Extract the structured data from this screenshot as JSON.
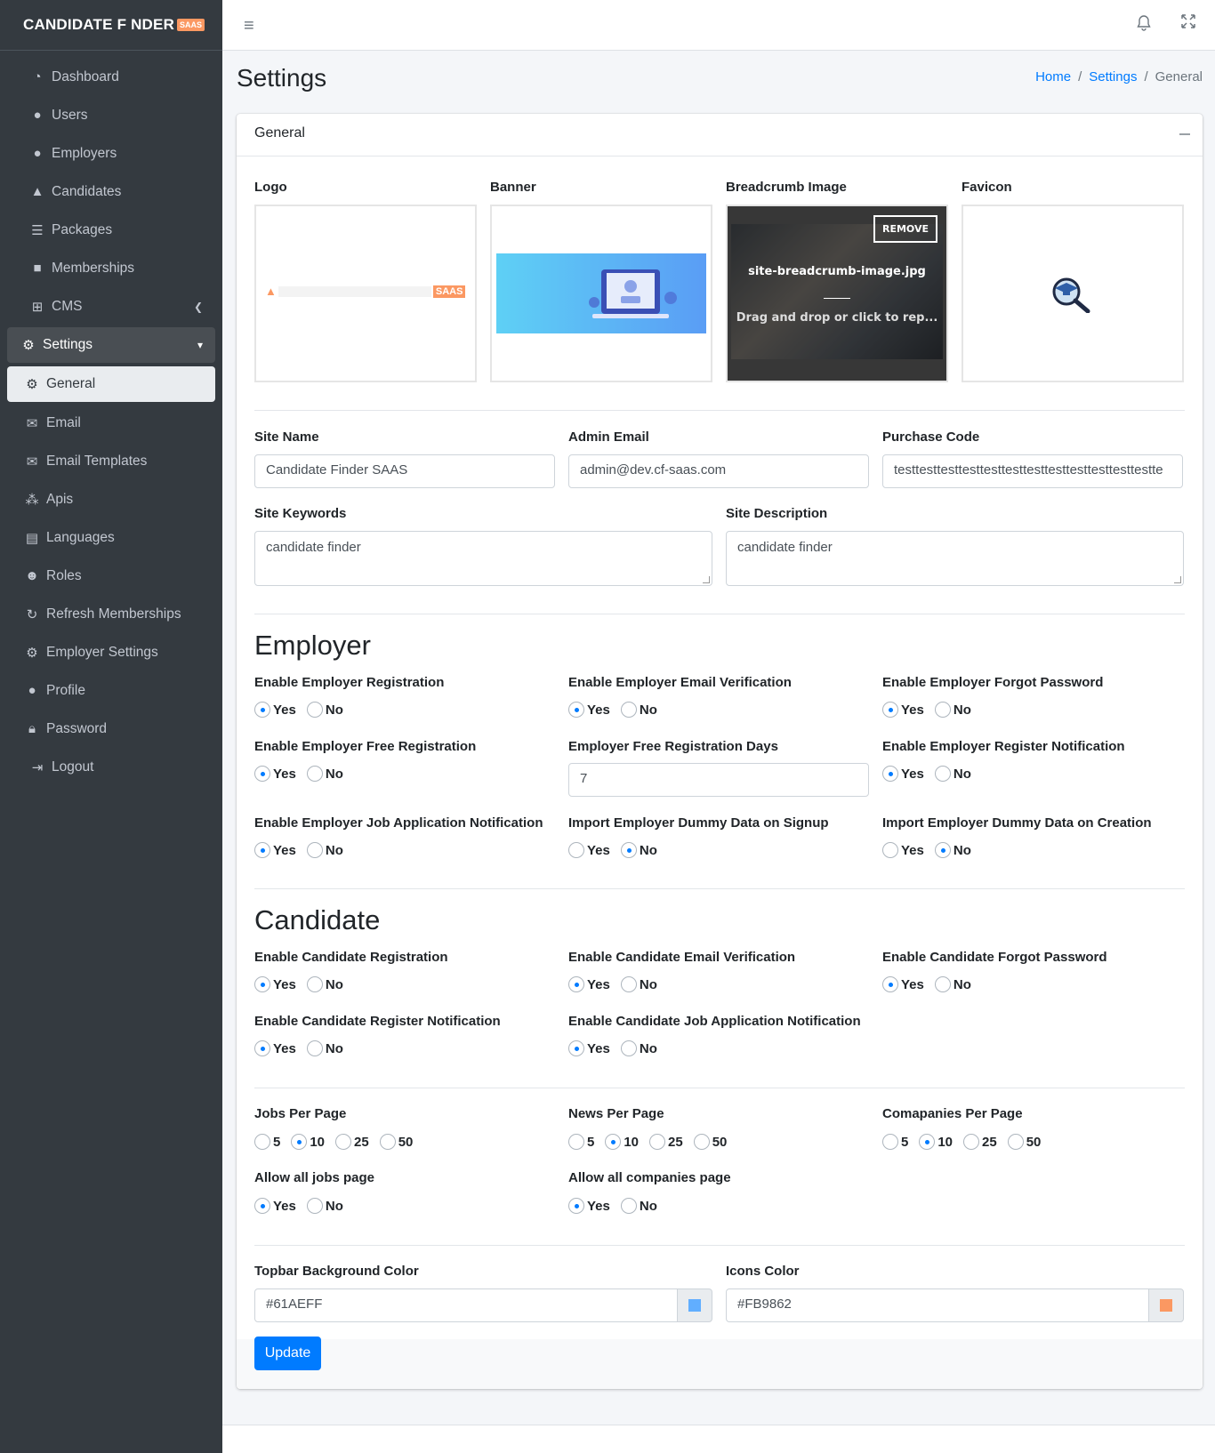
{
  "brand": {
    "name": "CANDIDATE F NDER",
    "badge": "SAAS"
  },
  "sidebar": {
    "items": [
      {
        "label": "Dashboard",
        "icon": "dashboard-icon"
      },
      {
        "label": "Users",
        "icon": "user-icon"
      },
      {
        "label": "Employers",
        "icon": "employer-icon"
      },
      {
        "label": "Candidates",
        "icon": "candidate-icon"
      },
      {
        "label": "Packages",
        "icon": "table-icon"
      },
      {
        "label": "Memberships",
        "icon": "membership-icon"
      },
      {
        "label": "CMS",
        "icon": "sitemap-icon"
      },
      {
        "label": "Settings",
        "icon": "cogs-icon"
      },
      {
        "label": "General",
        "icon": "cog-icon"
      },
      {
        "label": "Email",
        "icon": "envelope-icon"
      },
      {
        "label": "Email Templates",
        "icon": "envelope-icon"
      },
      {
        "label": "Apis",
        "icon": "api-icon"
      },
      {
        "label": "Languages",
        "icon": "language-icon"
      },
      {
        "label": "Roles",
        "icon": "users-cog-icon"
      },
      {
        "label": "Refresh Memberships",
        "icon": "refresh-icon"
      },
      {
        "label": "Employer Settings",
        "icon": "cog-icon"
      },
      {
        "label": "Profile",
        "icon": "user-icon"
      },
      {
        "label": "Password",
        "icon": "lock-icon"
      },
      {
        "label": "Logout",
        "icon": "sign-out-icon"
      }
    ]
  },
  "header": {
    "title": "Settings",
    "breadcrumb": [
      "Home",
      "Settings",
      "General"
    ]
  },
  "card": {
    "title": "General",
    "images": {
      "logo_label": "Logo",
      "banner_label": "Banner",
      "breadcrumb_label": "Breadcrumb Image",
      "favicon_label": "Favicon",
      "breadcrumb_file": "site-breadcrumb-image.jpg",
      "remove": "REMOVE",
      "drop_text": "Drag and drop or click to rep..."
    },
    "fields": {
      "site_name_label": "Site Name",
      "site_name_value": "Candidate Finder SAAS",
      "admin_email_label": "Admin Email",
      "admin_email_value": "admin@dev.cf-saas.com",
      "purchase_code_label": "Purchase Code",
      "purchase_code_value": "testtesttesttesttesttesttesttesttesttesttesttestte",
      "site_keywords_label": "Site Keywords",
      "site_keywords_value": "candidate finder",
      "site_description_label": "Site Description",
      "site_description_value": "candidate finder"
    },
    "employer": {
      "heading": "Employer",
      "enable_registration": "Enable Employer Registration",
      "enable_email_verification": "Enable Employer Email Verification",
      "enable_forgot_password": "Enable Employer Forgot Password",
      "enable_free_registration": "Enable Employer Free Registration",
      "free_registration_days_label": "Employer Free Registration Days",
      "free_registration_days_value": "7",
      "enable_register_notification": "Enable Employer Register Notification",
      "enable_job_app_notification": "Enable Employer Job Application Notification",
      "import_dummy_signup": "Import Employer Dummy Data on Signup",
      "import_dummy_creation": "Import Employer Dummy Data on Creation"
    },
    "candidate": {
      "heading": "Candidate",
      "enable_registration": "Enable Candidate Registration",
      "enable_email_verification": "Enable Candidate Email Verification",
      "enable_forgot_password": "Enable Candidate Forgot Password",
      "enable_register_notification": "Enable Candidate Register Notification",
      "enable_job_app_notification": "Enable Candidate Job Application Notification"
    },
    "paging": {
      "jobs_label": "Jobs Per Page",
      "news_label": "News Per Page",
      "companies_label": "Comapanies Per Page",
      "options": [
        "5",
        "10",
        "25",
        "50"
      ],
      "allow_jobs_label": "Allow all jobs page",
      "allow_companies_label": "Allow all companies page"
    },
    "colors": {
      "topbar_label": "Topbar Background Color",
      "topbar_value": "#61AEFF",
      "icons_label": "Icons Color",
      "icons_value": "#FB9862"
    },
    "yes": "Yes",
    "no": "No",
    "update": "Update"
  }
}
